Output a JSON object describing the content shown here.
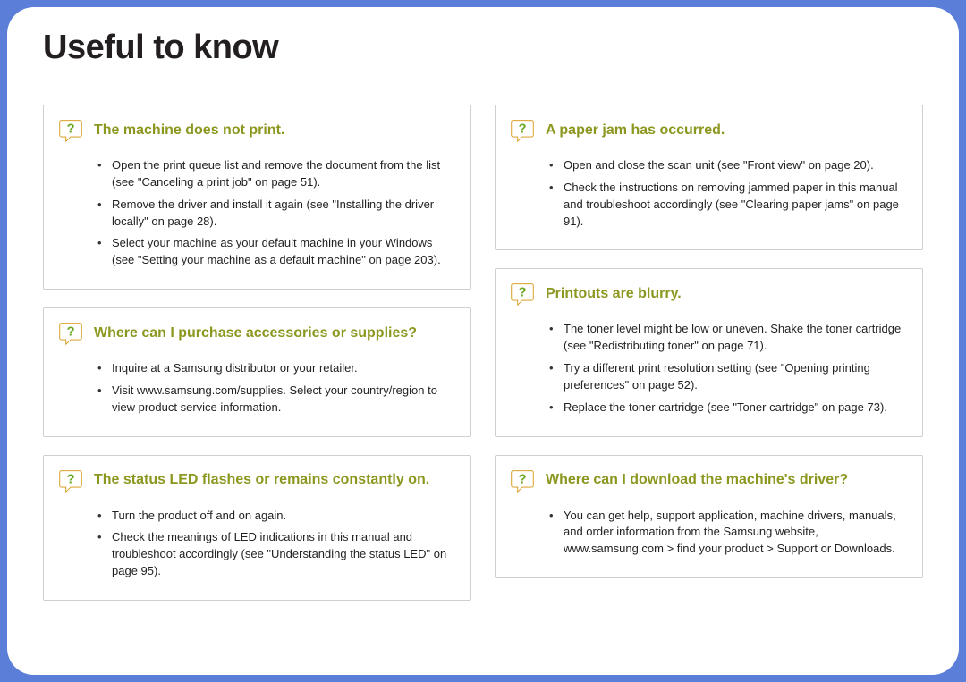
{
  "title": "Useful to know",
  "left": [
    {
      "heading": "The machine does not print.",
      "items": [
        "Open the print queue list and remove the document from the list (see \"Canceling a print job\" on page 51).",
        "Remove the driver and install it again (see \"Installing the driver locally\" on page 28).",
        "Select your machine as your default machine in your Windows (see \"Setting your machine as a default machine\" on page 203)."
      ]
    },
    {
      "heading": "Where can I purchase accessories or supplies?",
      "items": [
        "Inquire at a Samsung distributor or your retailer.",
        "Visit www.samsung.com/supplies. Select your country/region to view product service information."
      ]
    },
    {
      "heading": "The status LED flashes or remains constantly on.",
      "items": [
        "Turn the product off and on again.",
        "Check the meanings of LED indications in this manual and troubleshoot accordingly (see \"Understanding the status LED\" on page 95)."
      ]
    }
  ],
  "right": [
    {
      "heading": "A paper jam has occurred.",
      "items": [
        "Open and close the scan unit (see \"Front view\" on page 20).",
        "Check the instructions on removing jammed paper in this manual and troubleshoot accordingly (see \"Clearing paper jams\" on page 91)."
      ]
    },
    {
      "heading": "Printouts are blurry.",
      "items": [
        "The toner level might be low or uneven. Shake the toner cartridge (see \"Redistributing toner\" on page 71).",
        "Try a different print resolution setting (see \"Opening printing preferences\" on page 52).",
        "Replace the toner cartridge (see \"Toner cartridge\" on page 73)."
      ]
    },
    {
      "heading": "Where can I download the machine's driver?",
      "items": [
        "You can get help, support application, machine drivers, manuals, and order information from the Samsung website, www.samsung.com > find your product > Support or Downloads."
      ]
    }
  ]
}
